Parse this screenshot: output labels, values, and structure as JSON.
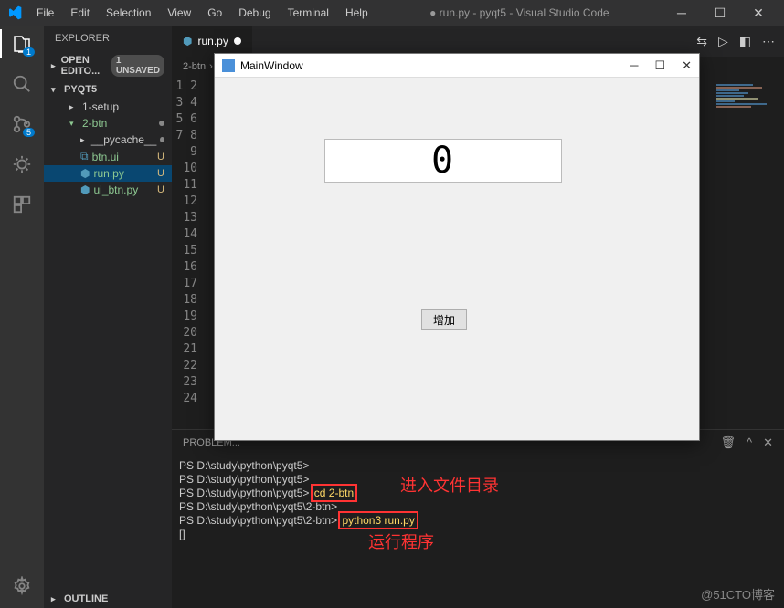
{
  "titlebar": {
    "menu": [
      "File",
      "Edit",
      "Selection",
      "View",
      "Go",
      "Debug",
      "Terminal",
      "Help"
    ],
    "title": "● run.py - pyqt5 - Visual Studio Code"
  },
  "activity": {
    "explorer_badge": "1",
    "scm_badge": "5"
  },
  "sidebar": {
    "header": "EXPLORER",
    "open_editors": "OPEN EDITO...",
    "unsaved": "1 UNSAVED",
    "root": "PYQT5",
    "items": [
      {
        "name": "1-setup",
        "kind": "folder"
      },
      {
        "name": "2-btn",
        "kind": "folder-open",
        "mod": "●"
      },
      {
        "name": "__pycache__",
        "kind": "folder",
        "nested": 2,
        "mod": "●"
      },
      {
        "name": "btn.ui",
        "kind": "file",
        "nested": 2,
        "mod": "U"
      },
      {
        "name": "run.py",
        "kind": "file",
        "nested": 2,
        "mod": "U",
        "active": true
      },
      {
        "name": "ui_btn.py",
        "kind": "file",
        "nested": 2,
        "mod": "U"
      }
    ],
    "outline": "OUTLINE"
  },
  "editor": {
    "tab": "run.py",
    "breadcrumb": [
      "2-btn"
    ],
    "line_count": 24
  },
  "dialog": {
    "title": "MainWindow",
    "lcd_value": "0",
    "button": "增加"
  },
  "terminal": {
    "tabs": [
      "PROBLEM..."
    ],
    "lines": [
      "PS D:\\study\\python\\pyqt5>",
      "PS D:\\study\\python\\pyqt5>",
      "PS D:\\study\\python\\pyqt5> ",
      "PS D:\\study\\python\\pyqt5\\2-btn>",
      "PS D:\\study\\python\\pyqt5\\2-btn> "
    ],
    "cmd1": "cd 2-btn",
    "cmd2": "python3 run.py",
    "cursor": "[]"
  },
  "annotations": {
    "a1": "进入文件目录",
    "a2": "运行程序"
  },
  "watermark": "@51CTO博客"
}
